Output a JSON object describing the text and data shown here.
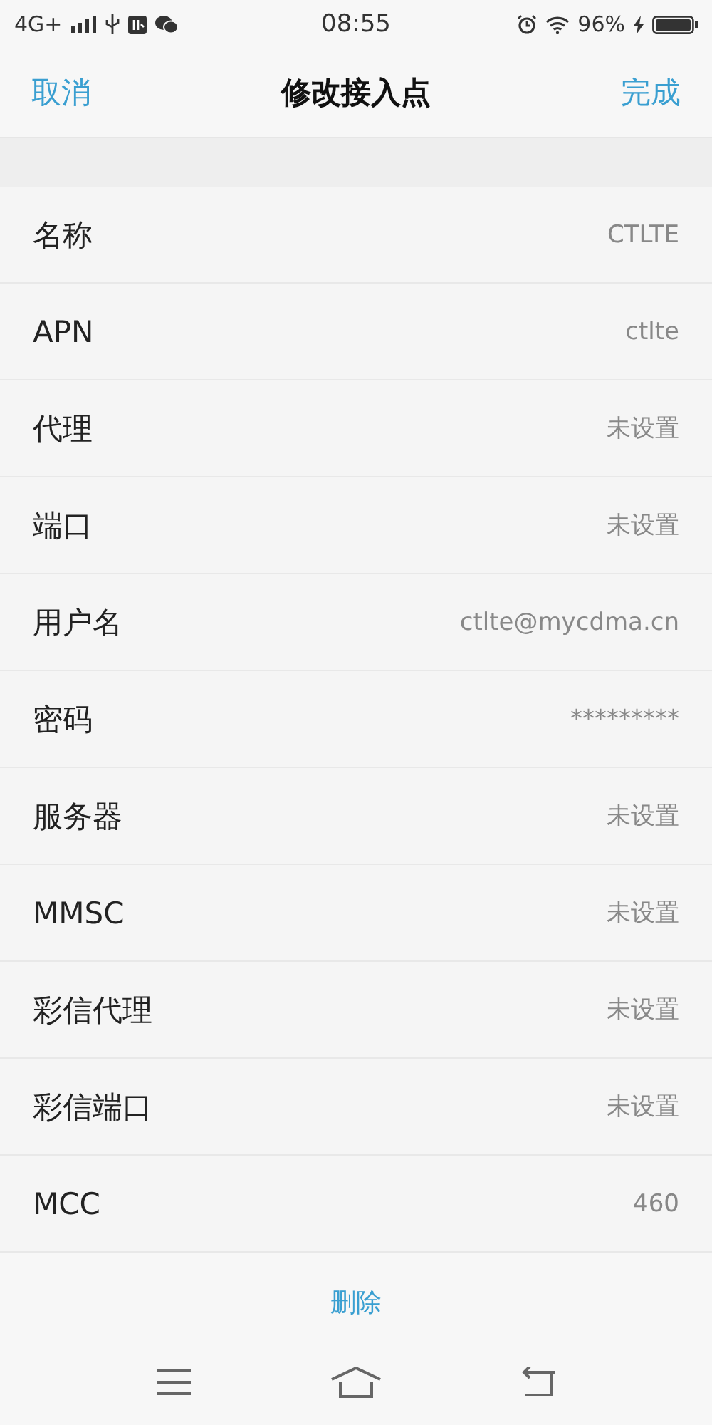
{
  "status_bar": {
    "network": "4G+",
    "time": "08:55",
    "battery": "96%"
  },
  "header": {
    "cancel": "取消",
    "title": "修改接入点",
    "done": "完成"
  },
  "fields": [
    {
      "label": "名称",
      "value": "CTLTE"
    },
    {
      "label": "APN",
      "value": "ctlte"
    },
    {
      "label": "代理",
      "value": "未设置"
    },
    {
      "label": "端口",
      "value": "未设置"
    },
    {
      "label": "用户名",
      "value": "ctlte@mycdma.cn"
    },
    {
      "label": "密码",
      "value": "*********"
    },
    {
      "label": "服务器",
      "value": "未设置"
    },
    {
      "label": "MMSC",
      "value": "未设置"
    },
    {
      "label": "彩信代理",
      "value": "未设置"
    },
    {
      "label": "彩信端口",
      "value": "未设置"
    },
    {
      "label": "MCC",
      "value": "460"
    }
  ],
  "delete_button": "删除"
}
